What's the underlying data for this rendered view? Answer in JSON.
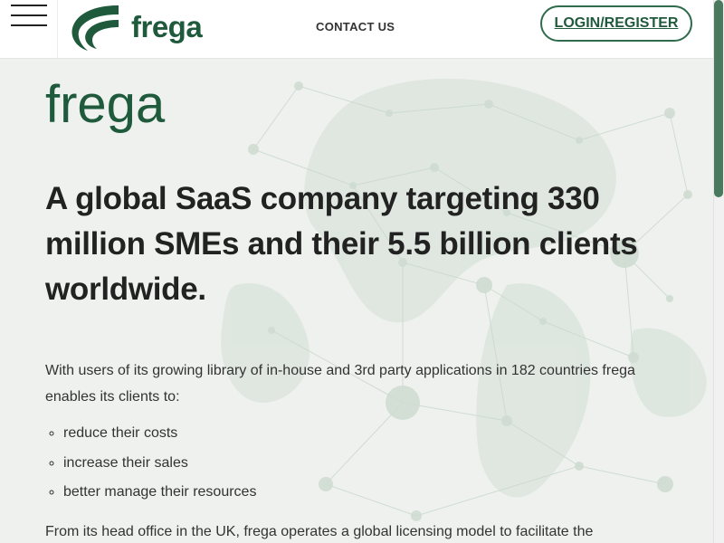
{
  "header": {
    "brand_name": "frega",
    "contact_label": "CONTACT US",
    "login_label": "LOGIN/REGISTER"
  },
  "main": {
    "brand_title": "frega",
    "headline": "A global SaaS company targeting 330 million SMEs and their 5.5 billion clients worldwide.",
    "intro": "With users of its growing library of in-house and 3rd party applications in 182 countries frega enables its clients to:",
    "benefits": [
      "reduce their costs",
      "increase their sales",
      "better manage their resources"
    ],
    "outro": "From its head office in the UK, frega operates a global licensing model to facilitate the"
  },
  "colors": {
    "brand_green": "#1f5a3c",
    "button_border": "#2f6b4d",
    "background": "#eef1ee",
    "scroll_thumb": "#4a7a5e",
    "text": "#222222"
  },
  "icons": {
    "menu": "hamburger-icon",
    "logo": "frega-logo-mark"
  }
}
